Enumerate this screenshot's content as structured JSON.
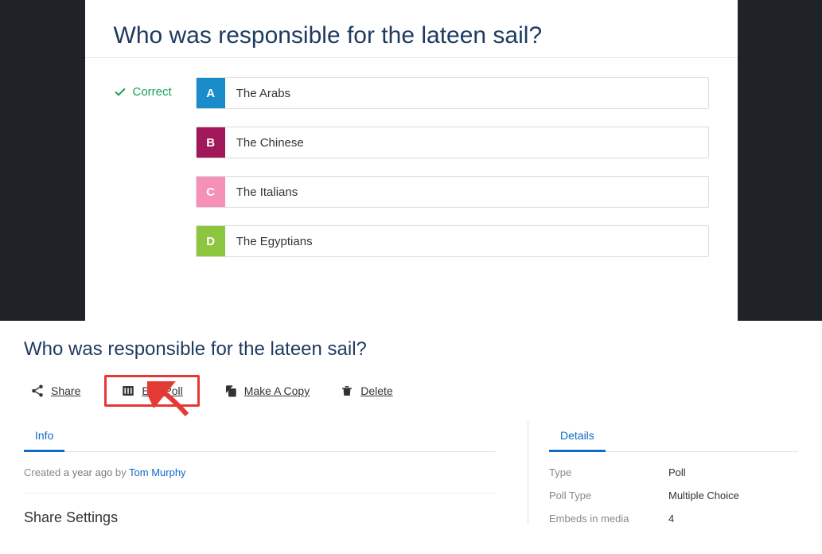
{
  "poll": {
    "question": "Who was responsible for the lateen sail?",
    "correct_label": "Correct",
    "answers": [
      {
        "letter": "A",
        "text": "The Arabs",
        "color_class": "letter-a"
      },
      {
        "letter": "B",
        "text": "The Chinese",
        "color_class": "letter-b"
      },
      {
        "letter": "C",
        "text": "The Italians",
        "color_class": "letter-c"
      },
      {
        "letter": "D",
        "text": "The Egyptians",
        "color_class": "letter-d"
      }
    ]
  },
  "lower": {
    "title": "Who was responsible for the lateen sail?",
    "actions": {
      "share": "Share",
      "edit": "Edit Poll",
      "copy": "Make A Copy",
      "delete": "Delete"
    },
    "tabs": {
      "info": "Info"
    },
    "created_prefix": "Created ",
    "created_time": "a year ago",
    "created_by": " by ",
    "author": "Tom Murphy",
    "share_heading": "Share Settings",
    "details": {
      "tab": "Details",
      "rows": [
        {
          "label": "Type",
          "value": "Poll"
        },
        {
          "label": "Poll Type",
          "value": "Multiple Choice"
        },
        {
          "label": "Embeds in media",
          "value": "4"
        }
      ]
    }
  }
}
